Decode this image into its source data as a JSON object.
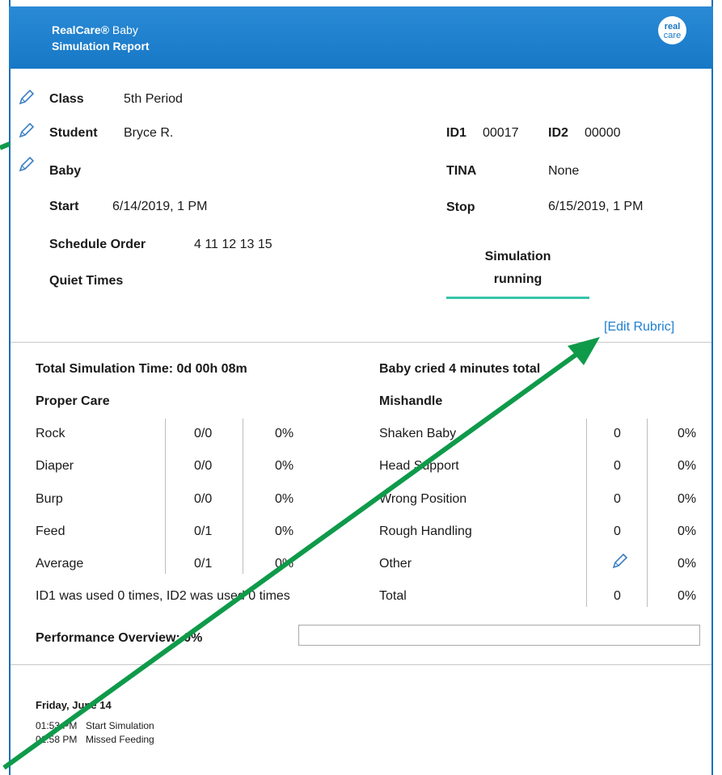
{
  "header": {
    "brand": "RealCare®",
    "product": "Baby",
    "subtitle": "Simulation Report",
    "logo_text_1": "real",
    "logo_text_2": "care"
  },
  "info": {
    "class_label": "Class",
    "class_value": "5th Period",
    "student_label": "Student",
    "student_value": "Bryce R.",
    "baby_label": "Baby",
    "start_label": "Start",
    "start_value": "6/14/2019, 1 PM",
    "schedule_label": "Schedule Order",
    "schedule_value": "4 11 12 13 15",
    "quiet_label": "Quiet Times",
    "id1_label": "ID1",
    "id1_value": "00017",
    "id2_label": "ID2",
    "id2_value": "00000",
    "tina_label": "TINA",
    "tina_value": "None",
    "stop_label": "Stop",
    "stop_value": "6/15/2019, 1 PM",
    "status_line1": "Simulation",
    "status_line2": "running",
    "edit_rubric": "[Edit Rubric]"
  },
  "summary": {
    "total_time": "Total Simulation Time: 0d 00h 08m",
    "cried": "Baby cried 4 minutes total",
    "proper_care_title": "Proper Care",
    "mishandle_title": "Mishandle",
    "proper_care": [
      {
        "label": "Rock",
        "count": "0/0",
        "pct": "0%"
      },
      {
        "label": "Diaper",
        "count": "0/0",
        "pct": "0%"
      },
      {
        "label": "Burp",
        "count": "0/0",
        "pct": "0%"
      },
      {
        "label": "Feed",
        "count": "0/1",
        "pct": "0%"
      },
      {
        "label": "Average",
        "count": "0/1",
        "pct": "0%"
      }
    ],
    "mishandle": [
      {
        "label": "Shaken Baby",
        "count": "0",
        "pct": "0%"
      },
      {
        "label": "Head Support",
        "count": "0",
        "pct": "0%"
      },
      {
        "label": "Wrong Position",
        "count": "0",
        "pct": "0%"
      },
      {
        "label": "Rough Handling",
        "count": "0",
        "pct": "0%"
      },
      {
        "label": "Other",
        "count": "",
        "pct": "0%"
      },
      {
        "label": "Total",
        "count": "0",
        "pct": "0%"
      }
    ],
    "id_usage": "ID1 was used 0 times, ID2 was used 0 times",
    "performance": "Performance Overview: 0%",
    "performance_value": 0
  },
  "log": {
    "date": "Friday, June 14",
    "entries": [
      {
        "time": "01:53 PM",
        "event": "Start Simulation"
      },
      {
        "time": "01:58 PM",
        "event": "Missed Feeding"
      }
    ]
  },
  "colors": {
    "header": "#1778c6",
    "accent": "#37c4a8",
    "link": "#1f7fd1",
    "arrow": "#0f9a4a"
  }
}
